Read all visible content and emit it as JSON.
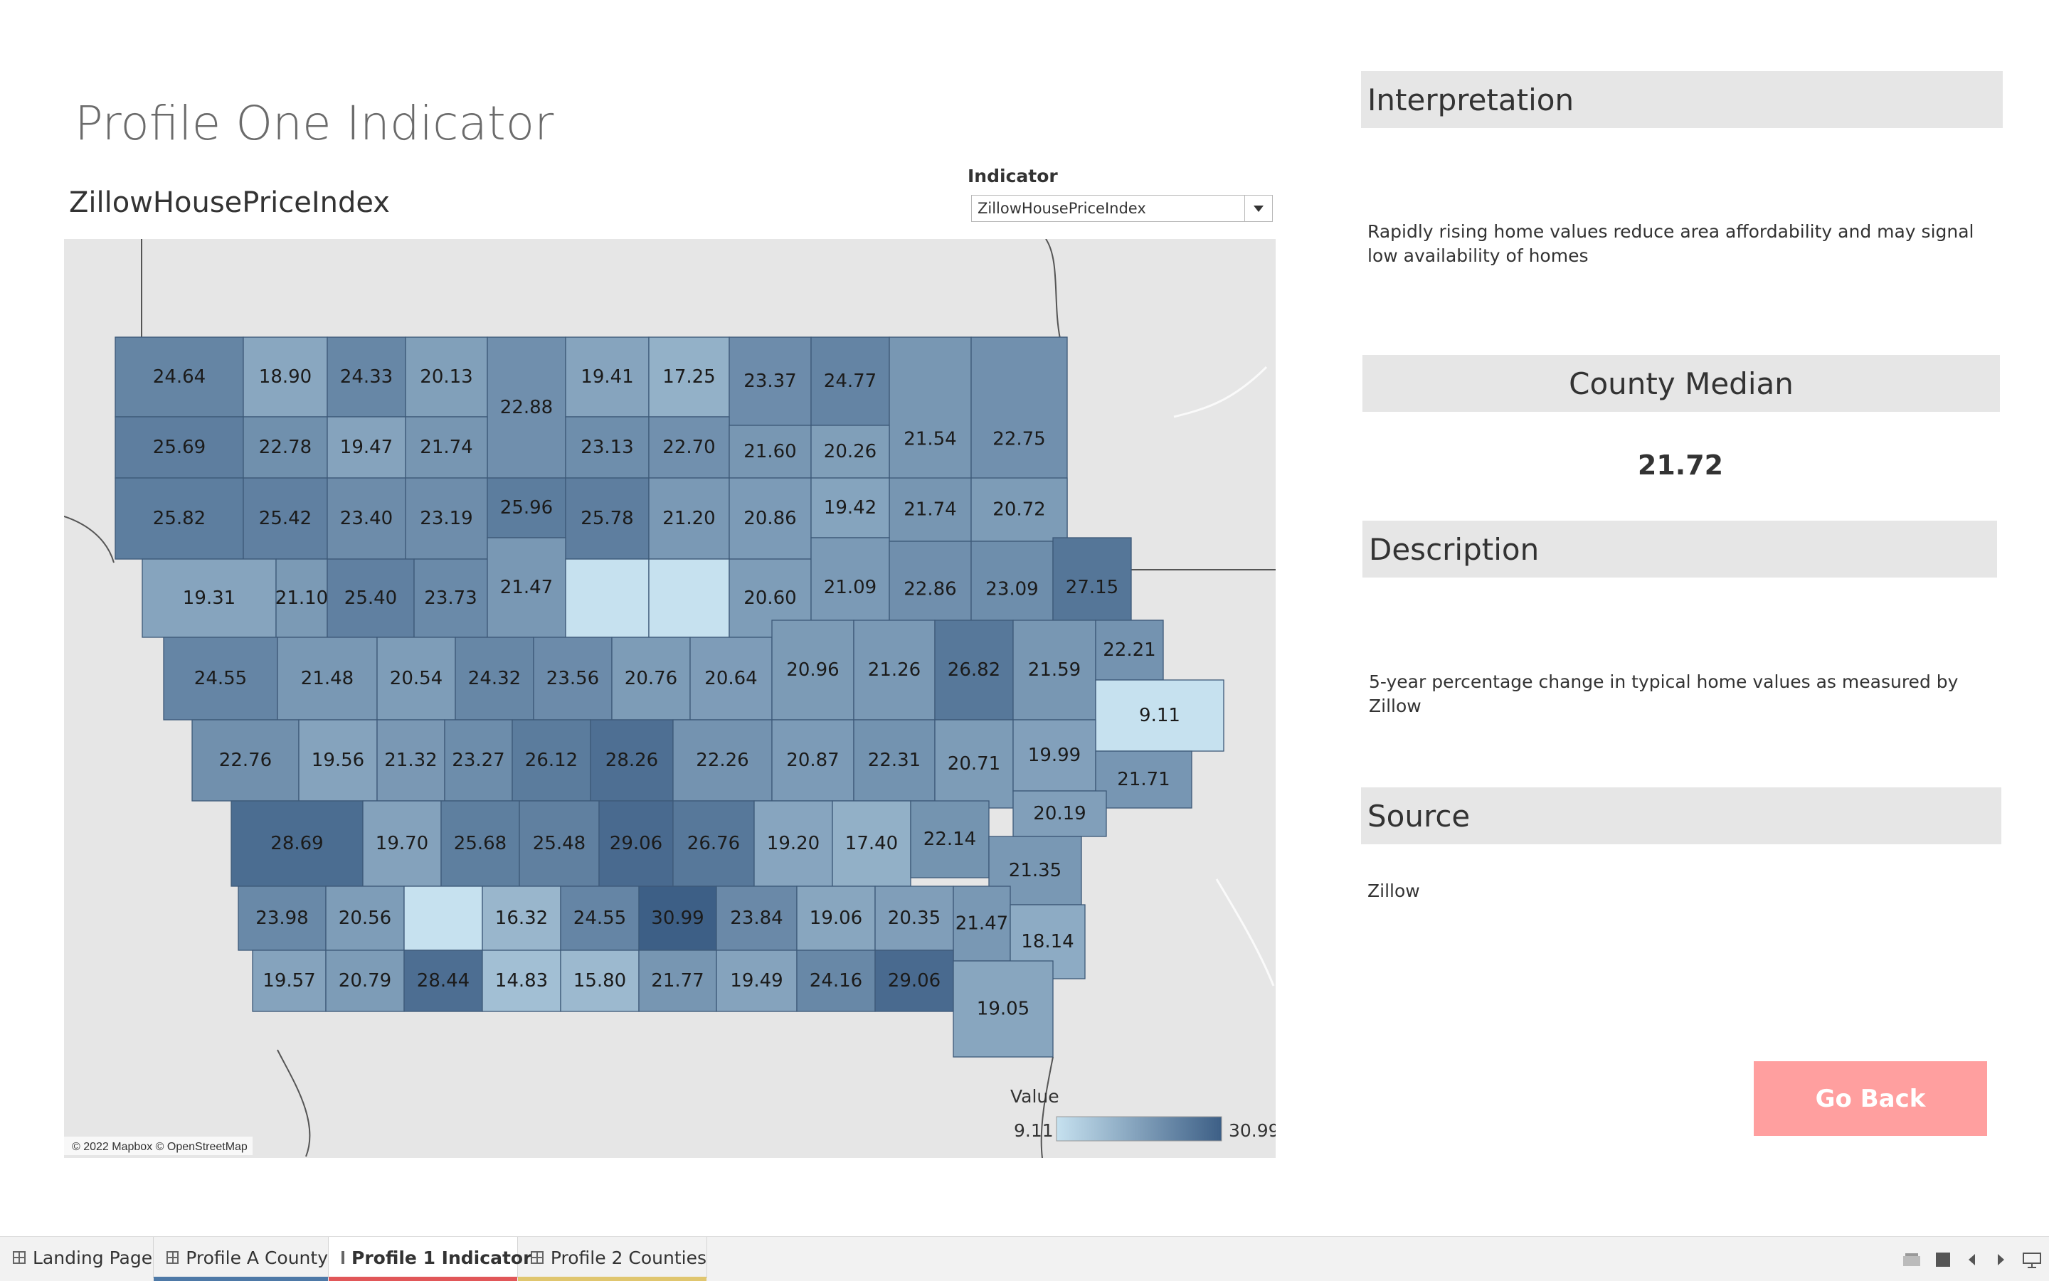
{
  "dashboard": {
    "title": "Profile One Indicator",
    "map_title": "ZillowHousePriceIndex"
  },
  "indicator": {
    "label": "Indicator",
    "selected": "ZillowHousePriceIndex"
  },
  "map": {
    "attribution": "© 2022 Mapbox © OpenStreetMap",
    "legend_title": "Value",
    "legend_min": "9.11",
    "legend_max": "30.99",
    "color_low": "#c6e1ef",
    "color_high": "#3d5f86",
    "county_values": [
      [
        24.64,
        18.9,
        24.33,
        20.13,
        22.88,
        19.41,
        17.25,
        23.37,
        24.77,
        21.54,
        22.75
      ],
      [
        25.69,
        22.78,
        19.47,
        21.74,
        23.13,
        22.7,
        21.6,
        20.26,
        21.74,
        20.72
      ],
      [
        25.82,
        25.42,
        23.4,
        23.19,
        25.96,
        25.78,
        21.2,
        20.86,
        19.42
      ],
      [
        19.31,
        21.1,
        25.4,
        23.73,
        21.47,
        null,
        null,
        20.6,
        21.09,
        22.86,
        23.09,
        27.15
      ],
      [
        24.55,
        21.48,
        20.54,
        24.32,
        23.56,
        20.76,
        20.64,
        20.96,
        21.26,
        26.82,
        21.59,
        22.21,
        9.11
      ],
      [
        22.76,
        19.56,
        21.32,
        23.27,
        26.12,
        28.26,
        22.26,
        20.87,
        22.31,
        20.71,
        19.99,
        21.71
      ],
      [
        28.69,
        19.7,
        25.68,
        25.48,
        29.06,
        26.76,
        19.2,
        17.4,
        22.14,
        20.19,
        21.35
      ],
      [
        23.98,
        20.56,
        null,
        16.32,
        24.55,
        30.99,
        23.84,
        19.06,
        20.35,
        21.47,
        18.14
      ],
      [
        19.57,
        20.79,
        28.44,
        14.83,
        15.8,
        21.77,
        19.49,
        24.16,
        29.06,
        19.05
      ]
    ],
    "county_labels": [
      [
        "24.64",
        "18.90",
        "24.33",
        "20.13",
        "22.88",
        "19.41",
        "17.25",
        "23.37",
        "24.77",
        "21.54",
        "22.75"
      ],
      [
        "25.69",
        "22.78",
        "19.47",
        "21.74",
        "23.13",
        "22.70",
        "21.60",
        "20.26",
        "21.74",
        "20.72"
      ],
      [
        "25.82",
        "25.42",
        "23.40",
        "23.19",
        "25.96",
        "25.78",
        "21.20",
        "20.86",
        "19.42"
      ],
      [
        "19.31",
        "21.10",
        "25.40",
        "23.73",
        "21.47",
        "",
        "",
        "20.60",
        "21.09",
        "22.86",
        "23.09",
        "27.15"
      ],
      [
        "24.55",
        "21.48",
        "20.54",
        "24.32",
        "23.56",
        "20.76",
        "20.64",
        "20.96",
        "21.26",
        "26.82",
        "21.59",
        "22.21",
        "9.11"
      ],
      [
        "22.76",
        "19.56",
        "21.32",
        "23.27",
        "26.12",
        "28.26",
        "22.26",
        "20.87",
        "22.31",
        "20.71",
        "19.99",
        "21.71"
      ],
      [
        "28.69",
        "19.70",
        "25.68",
        "25.48",
        "29.06",
        "26.76",
        "19.20",
        "17.40",
        "22.14",
        "20.19",
        "21.35"
      ],
      [
        "23.98",
        "20.56",
        "",
        "16.32",
        "24.55",
        "30.99",
        "23.84",
        "19.06",
        "20.35",
        "21.47",
        "18.14"
      ],
      [
        "19.57",
        "20.79",
        "28.44",
        "14.83",
        "15.80",
        "21.77",
        "19.49",
        "24.16",
        "29.06",
        "19.05"
      ]
    ]
  },
  "interpretation": {
    "header": "Interpretation",
    "text": "Rapidly rising home values reduce area affordability and may signal low availability of homes"
  },
  "county_median": {
    "header": "County Median",
    "value": "21.72"
  },
  "description": {
    "header": "Description",
    "text": "5-year percentage change in typical home values as measured by Zillow"
  },
  "source": {
    "header": "Source",
    "text": "Zillow"
  },
  "go_back": {
    "label": "Go Back",
    "color": "#ff9f9f"
  },
  "tabs": [
    {
      "label": "Landing Page",
      "active": false,
      "color": ""
    },
    {
      "label": "Profile A County",
      "active": false,
      "color": "#4e79a7"
    },
    {
      "label": "Profile 1 Indicator",
      "active": true,
      "color": "#e15759"
    },
    {
      "label": "Profile 2 Counties",
      "active": false,
      "color": "#e0c66f"
    }
  ],
  "icons": [
    "grid-sheet-icon",
    "layout-toggle-icon",
    "square-icon",
    "prev-arrow-icon",
    "next-arrow-icon",
    "presentation-icon"
  ]
}
